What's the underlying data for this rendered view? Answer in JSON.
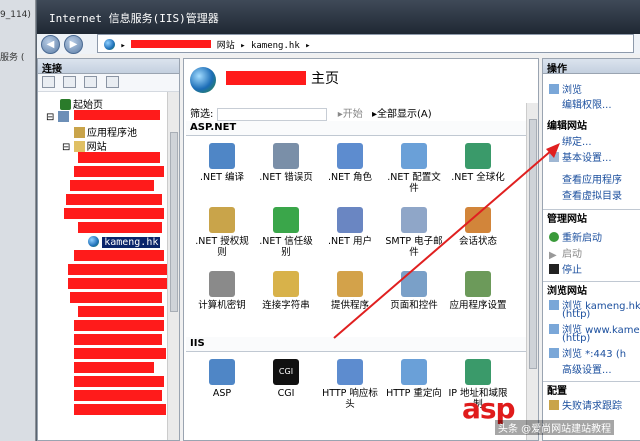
{
  "background_window": {
    "text1": "9_114)",
    "text2": "服务 ("
  },
  "window": {
    "title": "Internet 信息服务(IIS)管理器"
  },
  "address": {
    "part1": "网站",
    "part2": "kameng.hk"
  },
  "connections": {
    "header": "连接",
    "tree": [
      {
        "label": "起始页"
      },
      {
        "label": "应用程序池"
      },
      {
        "label": "网站"
      },
      {
        "label": "kameng.hk"
      }
    ]
  },
  "center": {
    "title": "主页",
    "filter": {
      "label": "筛选:",
      "start": "开始",
      "show_all": "全部显示(A)"
    },
    "sections": [
      {
        "title": "ASP.NET",
        "features": [
          {
            "label": ".NET 编译",
            "icon": "net-compile-icon"
          },
          {
            "label": ".NET 错误页",
            "icon": "net-error-icon"
          },
          {
            "label": ".NET 角色",
            "icon": "net-roles-icon"
          },
          {
            "label": ".NET 配置文件",
            "icon": "net-profile-icon"
          },
          {
            "label": ".NET 全球化",
            "icon": "net-globalization-icon"
          },
          {
            "label": ".NET 授权规则",
            "icon": "net-auth-icon"
          },
          {
            "label": ".NET 信任级别",
            "icon": "net-trust-icon"
          },
          {
            "label": ".NET 用户",
            "icon": "net-users-icon"
          },
          {
            "label": "SMTP 电子邮件",
            "icon": "smtp-icon"
          },
          {
            "label": "会话状态",
            "icon": "session-icon"
          },
          {
            "label": "计算机密钥",
            "icon": "machine-key-icon"
          },
          {
            "label": "连接字符串",
            "icon": "conn-string-icon"
          },
          {
            "label": "提供程序",
            "icon": "providers-icon"
          },
          {
            "label": "页面和控件",
            "icon": "pages-icon"
          },
          {
            "label": "应用程序设置",
            "icon": "app-settings-icon"
          }
        ]
      },
      {
        "title": "IIS",
        "features": [
          {
            "label": "ASP",
            "icon": "asp-icon"
          },
          {
            "label": "CGI",
            "icon": "cgi-icon"
          },
          {
            "label": "HTTP 响应标头",
            "icon": "http-headers-icon"
          },
          {
            "label": "HTTP 重定向",
            "icon": "http-redirect-icon"
          },
          {
            "label": "IP 地址和域限制",
            "icon": "ip-restrict-icon"
          }
        ]
      }
    ]
  },
  "actions": {
    "header": "操作",
    "items1": [
      "浏览",
      "编辑权限..."
    ],
    "edit_site_header": "编辑网站",
    "items2": [
      "绑定...",
      "基本设置...",
      "查看应用程序",
      "查看虚拟目录"
    ],
    "manage_header": "管理网站",
    "manage_items": [
      "重新启动",
      "启动",
      "停止"
    ],
    "browse_header": "浏览网站",
    "browse_items": [
      "浏览 kameng.hk",
      "(http)",
      "浏览 www.kamen",
      "(http)",
      "浏览 *:443 (h",
      "高级设置..."
    ],
    "config_header": "配置",
    "config_items": [
      "失败请求跟踪"
    ]
  },
  "watermark": {
    "brand": "asp",
    "sub": "头条 @爱尚网站建站教程"
  },
  "colors": {
    "redaction": "#ff1b1b",
    "link": "#1b4f9e",
    "arrow": "#e02020"
  }
}
